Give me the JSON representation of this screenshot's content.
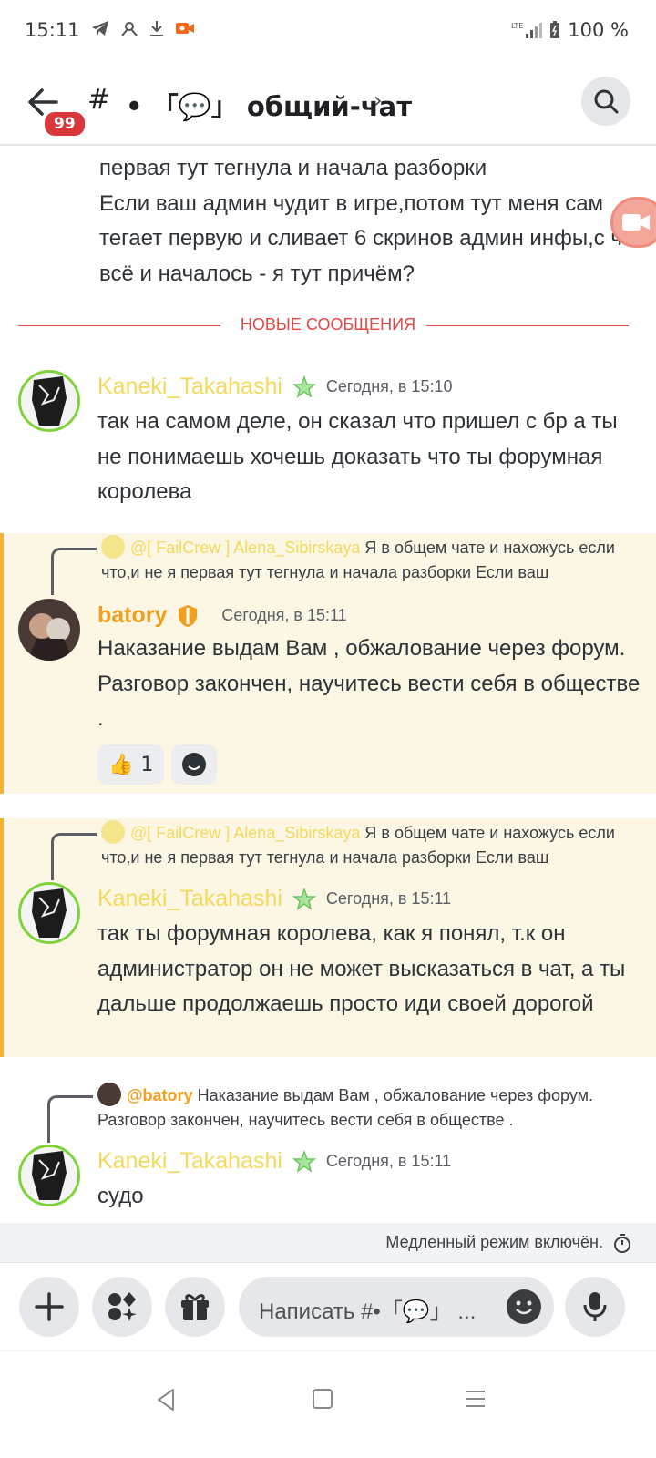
{
  "status_bar": {
    "time": "15:11",
    "network": "LTE",
    "battery": "100 %"
  },
  "header": {
    "unread_badge": "99",
    "channel_prefix": "#",
    "channel_name": "• 「💬」 общий-чат",
    "chevron": "›"
  },
  "previous_message": {
    "text": "первая тут тегнула и начала разборки\nЕсли ваш админ чудит в игре,потом тут меня сам тегает первую и сливает 6 скринов админ инфы,с чего всё и началось - я тут причём?"
  },
  "divider": {
    "label": "НОВЫЕ СООБЩЕНИЯ"
  },
  "messages": [
    {
      "author": "Kaneki_Takahashi",
      "time": "Сегодня, в 15:10",
      "text": "так на самом деле, он сказал что пришел с бр а ты не понимаешь хочешь доказать что ты форумная королева"
    },
    {
      "reply_mention": "@[ FailCrew ] Alena_Sibirskaya",
      "reply_text": " Я в общем чате и нахожусь если что,и не я первая тут тегнула и начала разборки  Если ваш",
      "author": "batory",
      "time": "Сегодня, в 15:11",
      "text": "Наказание выдам Вам , обжалование через форум. Разговор закончен, научитесь вести себя в обществе .",
      "reaction_count": "1"
    },
    {
      "reply_mention": "@[ FailCrew ] Alena_Sibirskaya",
      "reply_text": " Я в общем чате и нахожусь если что,и не я первая тут тегнула и начала разборки  Если ваш",
      "author": "Kaneki_Takahashi",
      "time": "Сегодня, в 15:11",
      "text": "так ты форумная королева, как я понял, т.к он администратор он не может высказаться в чат, а ты дальше продолжаешь просто иди своей дорогой"
    },
    {
      "reply_mention": "@batory",
      "reply_text": " Наказание выдам Вам , обжалование через форум. Разговор закончен, научитесь вести себя в обществе .",
      "author": "Kaneki_Takahashi",
      "time": "Сегодня, в 15:11",
      "text": "судо"
    }
  ],
  "slow_mode": {
    "text": "Медленный режим включён."
  },
  "composer": {
    "placeholder": "Написать #•「💬」 ..."
  },
  "colors": {
    "accent_new": "#e44545",
    "kaneki_name": "#f4d95c",
    "batory_name": "#f0a020",
    "highlight_bg": "#fcf6e4",
    "highlight_bar": "#f0b232"
  }
}
